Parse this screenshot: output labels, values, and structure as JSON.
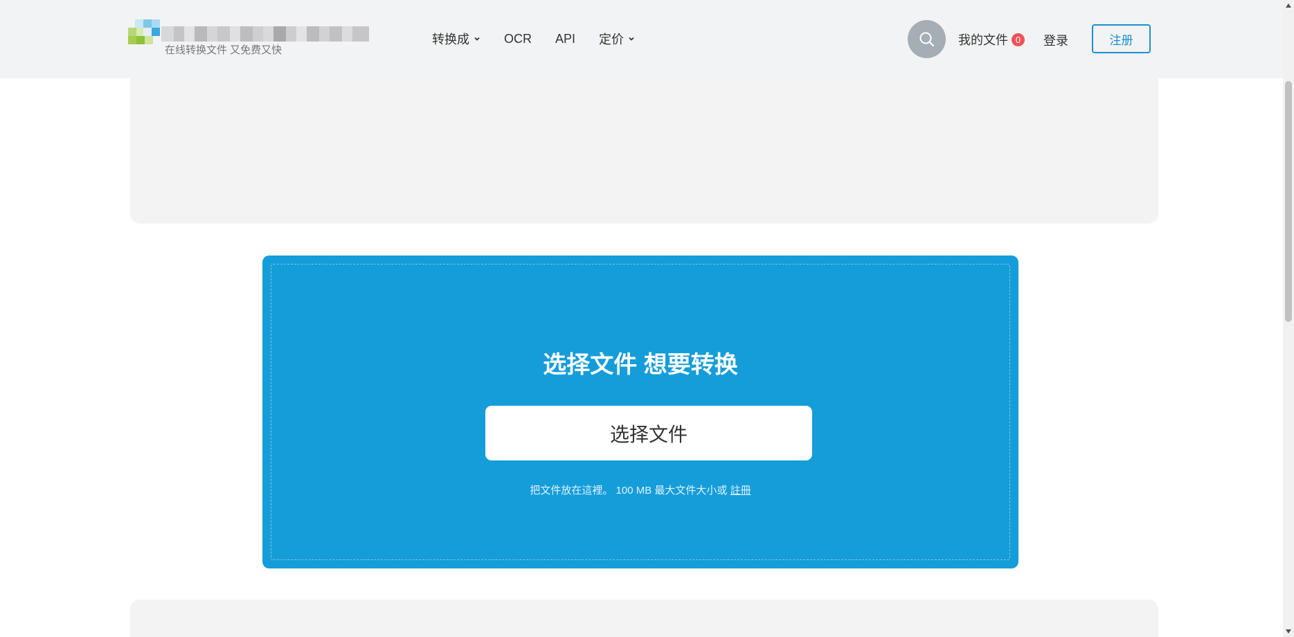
{
  "header": {
    "tagline": "在线转换文件 又免费又快",
    "nav": [
      {
        "label": "转换成",
        "has_dropdown": true
      },
      {
        "label": "OCR",
        "has_dropdown": false
      },
      {
        "label": "API",
        "has_dropdown": false
      },
      {
        "label": "定价",
        "has_dropdown": true
      }
    ],
    "search_icon": "search-icon",
    "my_files_label": "我的文件",
    "my_files_count": "0",
    "login_label": "登录",
    "register_label": "注册"
  },
  "upload": {
    "title": "选择文件 想要转换",
    "button_label": "选择文件",
    "hint_text": "把文件放在這裡。 100 MB 最大文件大小或",
    "hint_link": "註冊"
  },
  "colors": {
    "accent": "#159dd9",
    "register_border": "#1a8fcf",
    "badge": "#f0505a",
    "header_bg": "#f2f3f4"
  }
}
